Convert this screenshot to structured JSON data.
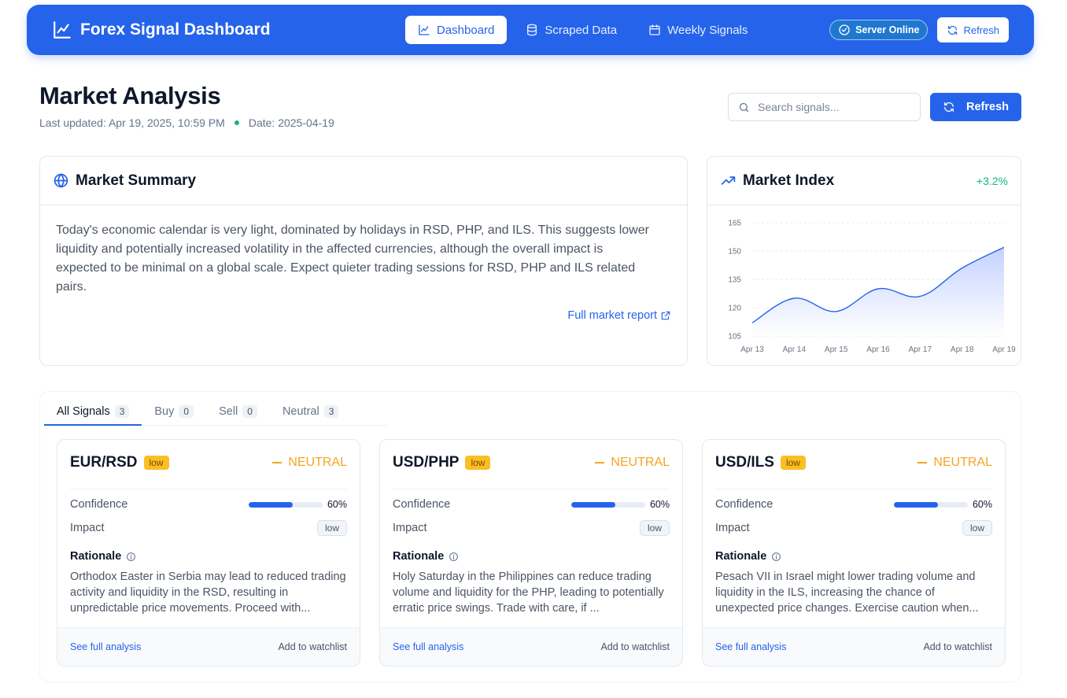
{
  "app": {
    "title": "Forex Signal Dashboard",
    "nav": [
      {
        "label": "Dashboard",
        "active": true
      },
      {
        "label": "Scraped Data",
        "active": false
      },
      {
        "label": "Weekly Signals",
        "active": false
      }
    ],
    "server_status": "Server Online",
    "refresh_label": "Refresh"
  },
  "header": {
    "title": "Market Analysis",
    "last_updated": "Last updated: Apr 19, 2025, 10:59 PM",
    "date": "Date: 2025-04-19",
    "search_placeholder": "Search signals...",
    "refresh_label": "Refresh"
  },
  "summary": {
    "title": "Market Summary",
    "text": "Today's economic calendar is very light, dominated by holidays in RSD, PHP, and ILS. This suggests lower liquidity and potentially increased volatility in the affected currencies, although the overall impact is expected to be minimal on a global scale. Expect quieter trading sessions for RSD, PHP and ILS related pairs.",
    "link": "Full market report"
  },
  "index": {
    "title": "Market Index",
    "change": "+3.2%"
  },
  "chart_data": {
    "type": "area",
    "x": [
      "Apr 13",
      "Apr 14",
      "Apr 15",
      "Apr 16",
      "Apr 17",
      "Apr 18",
      "Apr 19"
    ],
    "series": [
      {
        "values": [
          112,
          125,
          118,
          130,
          126,
          141,
          152
        ]
      }
    ],
    "ylim": [
      105,
      165
    ],
    "yticks": [
      105,
      120,
      135,
      150,
      165
    ],
    "grid": true,
    "title": "",
    "xlabel": "",
    "ylabel": "",
    "colors": {
      "line": "#2563eb",
      "fill_top": "#bfd0ff",
      "fill_bottom": "#ffffff"
    }
  },
  "tabs": [
    {
      "label": "All Signals",
      "count": "3",
      "active": true
    },
    {
      "label": "Buy",
      "count": "0",
      "active": false
    },
    {
      "label": "Sell",
      "count": "0",
      "active": false
    },
    {
      "label": "Neutral",
      "count": "3",
      "active": false
    }
  ],
  "signals": [
    {
      "pair": "EUR/RSD",
      "level": "low",
      "stance": "NEUTRAL",
      "confidence_label": "Confidence",
      "confidence": 60,
      "confidence_text": "60%",
      "impact_label": "Impact",
      "impact": "low",
      "rationale_label": "Rationale",
      "rationale": "Orthodox Easter in Serbia may lead to reduced trading activity and liquidity in the RSD, resulting in unpredictable price movements. Proceed with...",
      "see_label": "See full analysis",
      "watch_label": "Add to watchlist"
    },
    {
      "pair": "USD/PHP",
      "level": "low",
      "stance": "NEUTRAL",
      "confidence_label": "Confidence",
      "confidence": 60,
      "confidence_text": "60%",
      "impact_label": "Impact",
      "impact": "low",
      "rationale_label": "Rationale",
      "rationale": "Holy Saturday in the Philippines can reduce trading volume and liquidity for the PHP, leading to potentially erratic price swings. Trade with care, if ...",
      "see_label": "See full analysis",
      "watch_label": "Add to watchlist"
    },
    {
      "pair": "USD/ILS",
      "level": "low",
      "stance": "NEUTRAL",
      "confidence_label": "Confidence",
      "confidence": 60,
      "confidence_text": "60%",
      "impact_label": "Impact",
      "impact": "low",
      "rationale_label": "Rationale",
      "rationale": "Pesach VII in Israel might lower trading volume and liquidity in the ILS, increasing the chance of unexpected price changes. Exercise caution when...",
      "see_label": "See full analysis",
      "watch_label": "Add to watchlist"
    }
  ]
}
